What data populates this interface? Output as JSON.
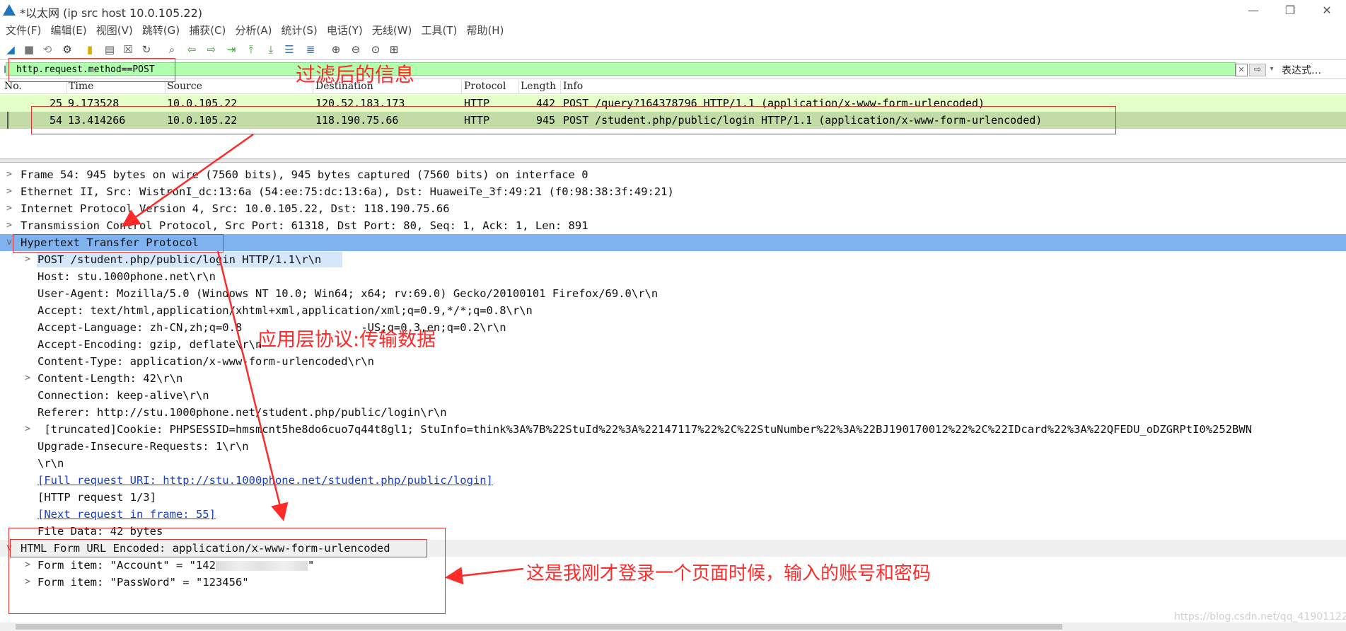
{
  "window": {
    "title": "*以太网 (ip src host 10.0.105.22)",
    "minimize": "—",
    "restore": "❐",
    "close": "✕"
  },
  "menu": [
    "文件(F)",
    "编辑(E)",
    "视图(V)",
    "跳转(G)",
    "捕获(C)",
    "分析(A)",
    "统计(S)",
    "电话(Y)",
    "无线(W)",
    "工具(T)",
    "帮助(H)"
  ],
  "filter": {
    "value": "http.request.method==POST",
    "expression_button": "表达式…"
  },
  "packet_list": {
    "columns": [
      "No.",
      "Time",
      "Source",
      "Destination",
      "Protocol",
      "Length",
      "Info"
    ],
    "rows": [
      {
        "no": "25",
        "time": "9.173528",
        "source": "10.0.105.22",
        "destination": "120.52.183.173",
        "protocol": "HTTP",
        "length": "442",
        "info": "POST /query?164378796 HTTP/1.1  (application/x-www-form-urlencoded)"
      },
      {
        "no": "54",
        "time": "13.414266",
        "source": "10.0.105.22",
        "destination": "118.190.75.66",
        "protocol": "HTTP",
        "length": "945",
        "info": "POST /student.php/public/login HTTP/1.1  (application/x-www-form-urlencoded)"
      }
    ]
  },
  "details": [
    {
      "text": "Frame 54: 945 bytes on wire (7560 bits), 945 bytes captured (7560 bits) on interface 0",
      "arrow": ">"
    },
    {
      "text": "Ethernet II, Src: WistronI_dc:13:6a (54:ee:75:dc:13:6a), Dst: HuaweiTe_3f:49:21 (f0:98:38:3f:49:21)",
      "arrow": ">"
    },
    {
      "text": "Internet Protocol Version 4, Src: 10.0.105.22, Dst: 118.190.75.66",
      "arrow": ">"
    },
    {
      "text": "Transmission Control Protocol, Src Port: 61318, Dst Port: 80, Seq: 1, Ack: 1, Len: 891",
      "arrow": ">"
    },
    {
      "text": "Hypertext Transfer Protocol",
      "arrow": "v"
    },
    {
      "text": "POST /student.php/public/login HTTP/1.1\\r\\n",
      "arrow": ">"
    },
    {
      "text": "Host: stu.1000phone.net\\r\\n",
      "arrow": ""
    },
    {
      "text": "User-Agent: Mozilla/5.0 (Windows NT 10.0; Win64; x64; rv:69.0) Gecko/20100101 Firefox/69.0\\r\\n",
      "arrow": ""
    },
    {
      "text": "Accept: text/html,application/xhtml+xml,application/xml;q=0.9,*/*;q=0.8\\r\\n",
      "arrow": ""
    },
    {
      "text": "Accept-Language: zh-CN,zh;q=0.8                  -US;q=0.3,en;q=0.2\\r\\n",
      "arrow": ""
    },
    {
      "text": "Accept-Encoding: gzip, deflate\\r\\n",
      "arrow": ""
    },
    {
      "text": "Content-Type: application/x-www-form-urlencoded\\r\\n",
      "arrow": ""
    },
    {
      "text": "Content-Length: 42\\r\\n",
      "arrow": ">"
    },
    {
      "text": "Connection: keep-alive\\r\\n",
      "arrow": ""
    },
    {
      "text": "Referer: http://stu.1000phone.net/student.php/public/login\\r\\n",
      "arrow": ""
    },
    {
      "text": " [truncated]Cookie: PHPSESSID=hmsmcnt5he8do6cuo7q44t8gl1; StuInfo=think%3A%7B%22StuId%22%3A%22147117%22%2C%22StuNumber%22%3A%22BJ190170012%22%2C%22IDcard%22%3A%22QFEDU_oDZGRPtI0%252BWN",
      "arrow": ">"
    },
    {
      "text": "Upgrade-Insecure-Requests: 1\\r\\n",
      "arrow": ""
    },
    {
      "text": "\\r\\n",
      "arrow": ""
    },
    {
      "text": "[Full request URI: http://stu.1000phone.net/student.php/public/login]",
      "arrow": "",
      "link": true
    },
    {
      "text": "[HTTP request 1/3]",
      "arrow": ""
    },
    {
      "text": "[Next request in frame: 55]",
      "arrow": "",
      "link": true
    },
    {
      "text": "File Data: 42 bytes",
      "arrow": ""
    },
    {
      "text": "HTML Form URL Encoded: application/x-www-form-urlencoded",
      "arrow": "v"
    },
    {
      "text_prefix": "Form item: \"Account\" = \"142",
      "text_suffix": "\"",
      "arrow": ">"
    },
    {
      "text": "Form item: \"PassWord\" = \"123456\"",
      "arrow": ">"
    }
  ],
  "annotations": {
    "filtered_info": "过滤后的信息",
    "app_layer": "应用层协议:传输数据",
    "login_note": "这是我刚才登录一个页面时候，输入的账号和密码"
  },
  "watermark": "https://blog.csdn.net/qq_41901122",
  "colors": {
    "filter_bg": "#afffaf",
    "row_http_bg": "#e4ffc7",
    "row_selected_bg": "#c3dca7",
    "detail_selected_bg": "#7fb3ef",
    "annotation_red": "#ff2a2a"
  }
}
